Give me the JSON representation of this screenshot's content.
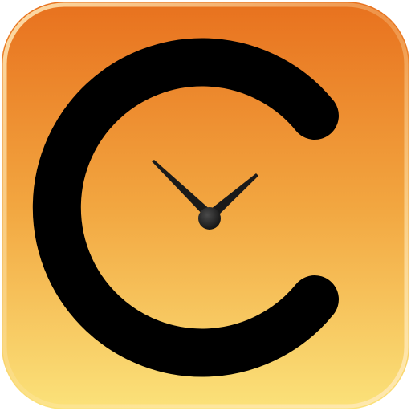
{
  "icon": {
    "glyph": "clock-c-logo",
    "colors": {
      "gradient_top": "#E8711E",
      "gradient_mid": "#F2A640",
      "gradient_bottom": "#FBE27A",
      "rim_light": "#FFE9B8",
      "glyph": "#000000",
      "hands": "#1A1A1A"
    }
  }
}
